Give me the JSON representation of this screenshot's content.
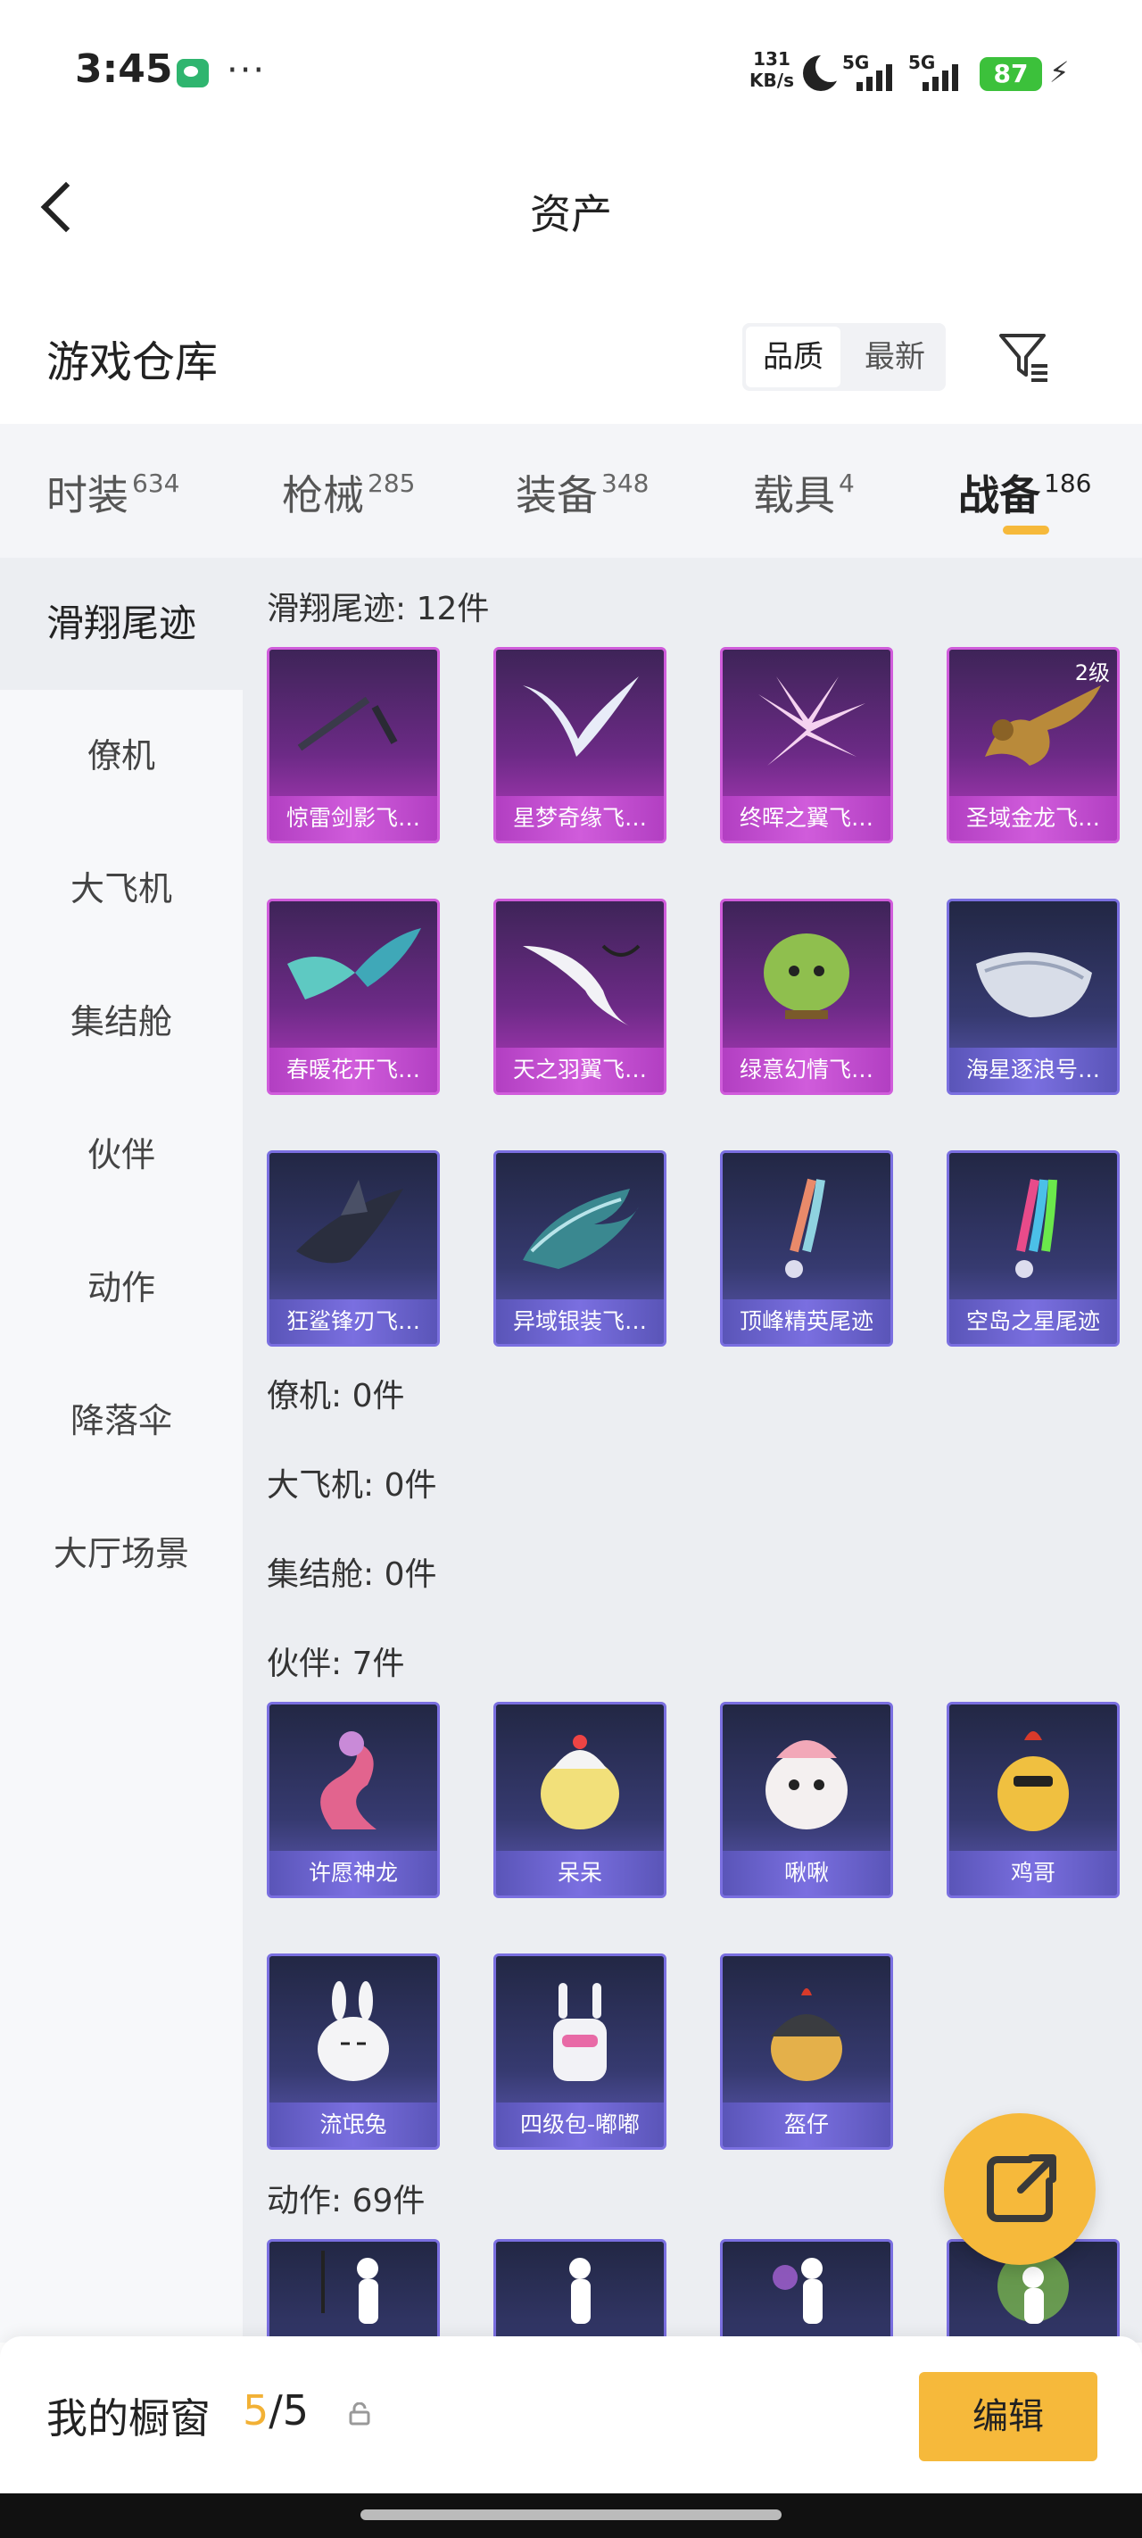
{
  "status_bar": {
    "time": "3:45",
    "net_speed_value": "131",
    "net_speed_unit": "KB/s",
    "sim1_label": "5G",
    "sim2_label": "5G",
    "battery": "87"
  },
  "header": {
    "title": "资产"
  },
  "warehouse": {
    "title": "游戏仓库",
    "sort_quality": "品质",
    "sort_newest": "最新"
  },
  "tabs": [
    {
      "label": "时装",
      "count": "634"
    },
    {
      "label": "枪械",
      "count": "285"
    },
    {
      "label": "装备",
      "count": "348"
    },
    {
      "label": "载具",
      "count": "4"
    },
    {
      "label": "战备",
      "count": "186"
    }
  ],
  "sidebar": {
    "items": [
      {
        "label": "滑翔尾迹"
      },
      {
        "label": "僚机"
      },
      {
        "label": "大飞机"
      },
      {
        "label": "集结舱"
      },
      {
        "label": "伙伴"
      },
      {
        "label": "动作"
      },
      {
        "label": "降落伞"
      },
      {
        "label": "大厅场景"
      }
    ]
  },
  "groups": {
    "glide": {
      "label": "滑翔尾迹: 12件",
      "items": [
        {
          "name": "惊雷剑影飞…",
          "quality": "purple"
        },
        {
          "name": "星梦奇缘飞…",
          "quality": "purple"
        },
        {
          "name": "终晖之翼飞…",
          "quality": "purple"
        },
        {
          "name": "圣域金龙飞…",
          "quality": "purple",
          "level": "2级"
        },
        {
          "name": "春暖花开飞…",
          "quality": "purple"
        },
        {
          "name": "天之羽翼飞…",
          "quality": "purple"
        },
        {
          "name": "绿意幻情飞…",
          "quality": "purple"
        },
        {
          "name": "海星逐浪号…",
          "quality": "blue"
        },
        {
          "name": "狂鲨锋刃飞…",
          "quality": "blue"
        },
        {
          "name": "异域银装飞…",
          "quality": "blue"
        },
        {
          "name": "顶峰精英尾迹",
          "quality": "blue"
        },
        {
          "name": "空岛之星尾迹",
          "quality": "blue"
        }
      ]
    },
    "wingman": {
      "label": "僚机: 0件"
    },
    "big_plane": {
      "label": "大飞机: 0件"
    },
    "assembly": {
      "label": "集结舱: 0件"
    },
    "partner": {
      "label": "伙伴: 7件",
      "items": [
        {
          "name": "许愿神龙",
          "quality": "blue"
        },
        {
          "name": "呆呆",
          "quality": "blue"
        },
        {
          "name": "啾啾",
          "quality": "blue"
        },
        {
          "name": "鸡哥",
          "quality": "blue"
        },
        {
          "name": "流氓兔",
          "quality": "blue"
        },
        {
          "name": "四级包-嘟嘟",
          "quality": "blue"
        },
        {
          "name": "盔仔",
          "quality": "blue"
        }
      ]
    },
    "emote": {
      "label": "动作: 69件"
    }
  },
  "bottom": {
    "showcase_label": "我的橱窗",
    "showcase_current": "5",
    "showcase_total": "/5",
    "edit": "编辑"
  },
  "colors": {
    "accent": "#f6b93b",
    "purple_quality": "#d05cdb",
    "blue_quality": "#7a6fe0"
  }
}
